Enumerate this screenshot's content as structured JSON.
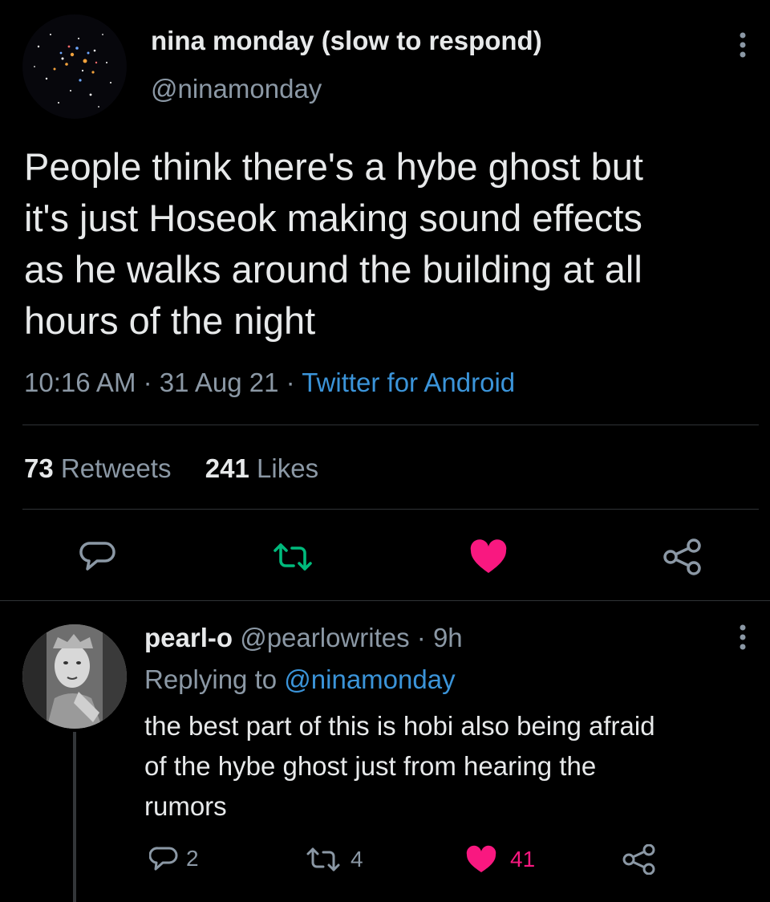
{
  "tweet": {
    "display_name": "nina monday (slow to respond)",
    "handle": "@ninamonday",
    "text_lines": [
      "People think there's a hybe ghost but",
      "it's just Hoseok making sound effects",
      "as he walks around the building at all",
      "hours of the night"
    ],
    "time": "10:16 AM",
    "sep1": "·",
    "date": "31 Aug 21",
    "sep2": "·",
    "source": "Twitter for Android",
    "retweets_count": "73",
    "retweets_label": "Retweets",
    "likes_count": "241",
    "likes_label": "Likes"
  },
  "reply": {
    "display_name": "pearl-o",
    "handle": "@pearlowrites",
    "sep": "·",
    "age": "9h",
    "replying_prefix": "Replying to",
    "replying_to": "@ninamonday",
    "text_lines": [
      "the best part of this is hobi also being afraid",
      "of the hybe ghost just from hearing the",
      "rumors"
    ],
    "reply_count": "2",
    "retweet_count": "4",
    "like_count": "41"
  },
  "icons": {
    "more": "more-vertical-icon",
    "reply": "reply-icon",
    "retweet": "retweet-icon",
    "like": "heart-icon",
    "share": "share-icon"
  },
  "colors": {
    "background": "#000000",
    "text": "#e7e9ea",
    "muted": "#8b98a5",
    "link": "#3b94d9",
    "retweet_active": "#00ba7c",
    "like_active": "#f91880"
  }
}
